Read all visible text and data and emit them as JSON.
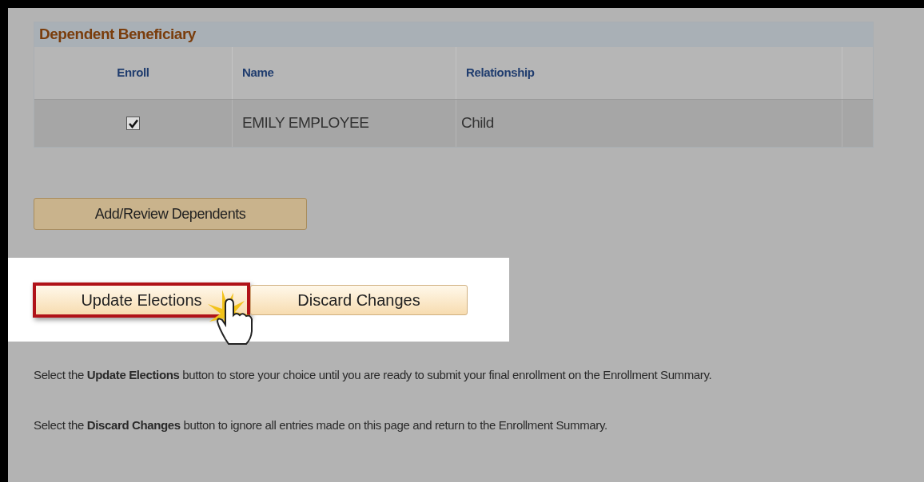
{
  "grid": {
    "title": "Dependent Beneficiary",
    "columns": [
      "Enroll",
      "Name",
      "Relationship"
    ],
    "rows": [
      {
        "enrolled": true,
        "name": "EMILY EMPLOYEE",
        "relationship": "Child"
      }
    ]
  },
  "add_button": "Add/Review Dependents",
  "action_buttons": [
    {
      "label": "Update Elections",
      "highlighted": true
    },
    {
      "label": "Discard Changes",
      "highlighted": false
    }
  ],
  "instructions": [
    "Select the **Update Elections** button to store your choice until you are ready to submit your final enrollment on the Enrollment Summary.",
    "Select the **Discard Changes** button to ignore all entries made on this page and return to the Enrollment Summary."
  ]
}
